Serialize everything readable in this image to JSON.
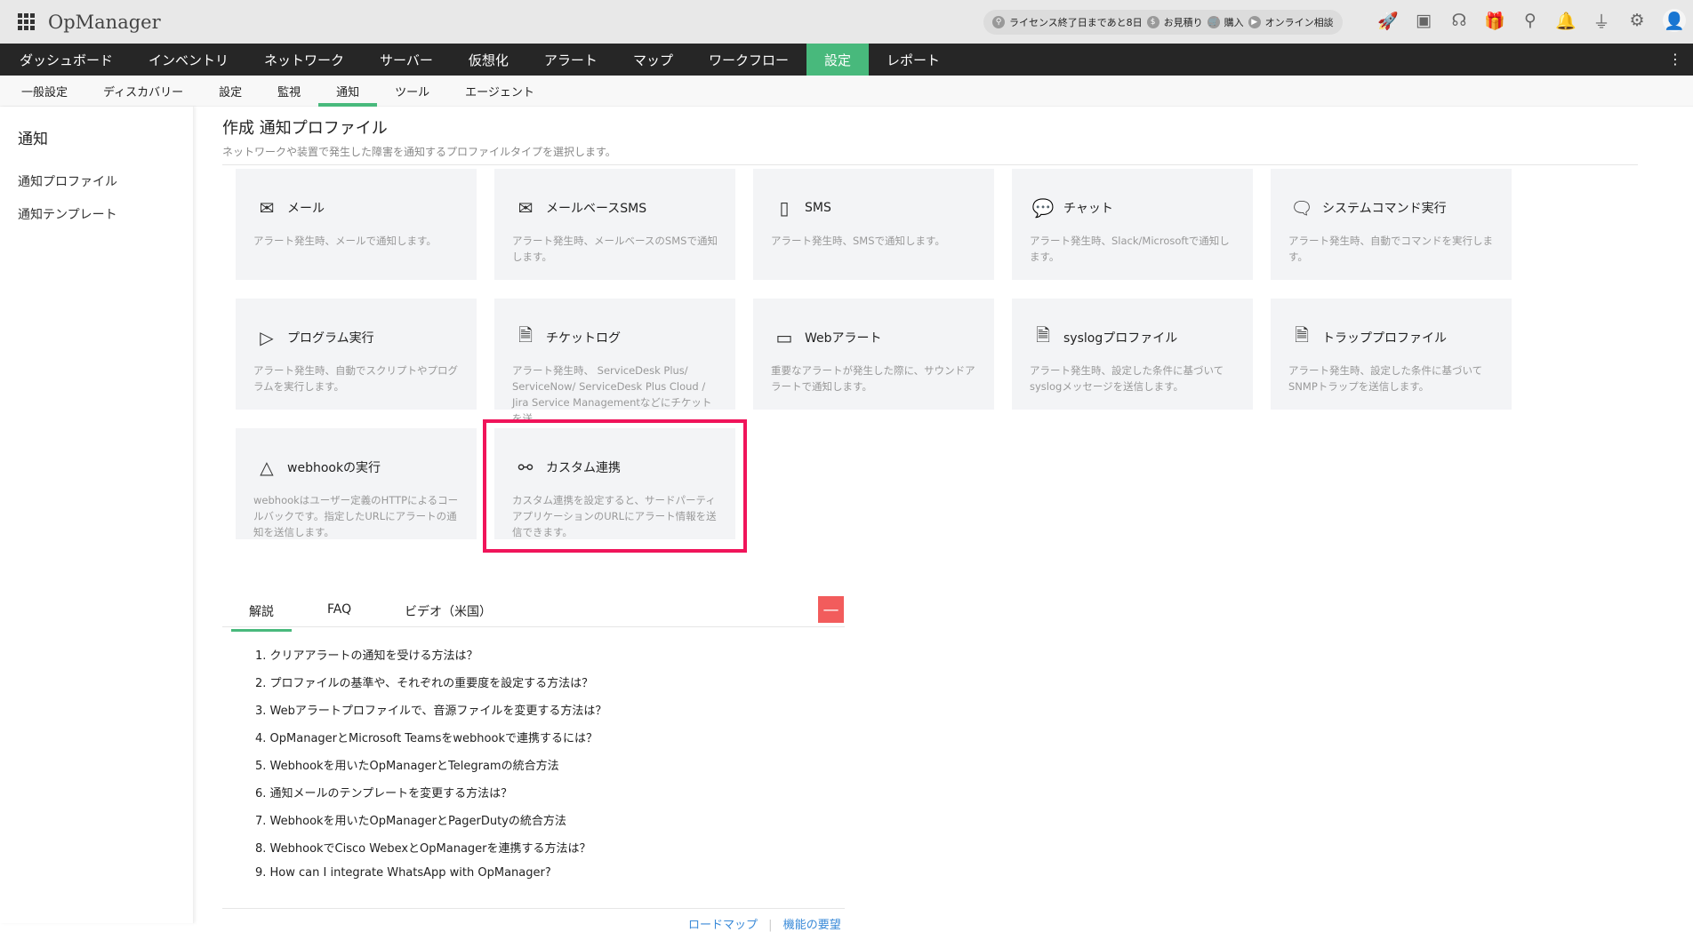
{
  "app": {
    "title": "OpManager"
  },
  "topbar": {
    "license": "ライセンス終了日まであと8日",
    "quote": "お見積り",
    "purchase": "購入",
    "consult": "オンライン相談"
  },
  "nav": [
    "ダッシュボード",
    "インベントリ",
    "ネットワーク",
    "サーバー",
    "仮想化",
    "アラート",
    "マップ",
    "ワークフロー",
    "設定",
    "レポート"
  ],
  "subnav": [
    "一般設定",
    "ディスカバリー",
    "設定",
    "監視",
    "通知",
    "ツール",
    "エージェント"
  ],
  "sidebar": {
    "title": "通知",
    "items": [
      "通知プロファイル",
      "通知テンプレート"
    ]
  },
  "main": {
    "title": "作成 通知プロファイル",
    "subtitle": "ネットワークや装置で発生した障害を通知するプロファイルタイプを選択します。",
    "cards": [
      {
        "title": "メール",
        "desc": "アラート発生時、メールで通知します。",
        "icon": "mail-icon"
      },
      {
        "title": "メールベースSMS",
        "desc": "アラート発生時、メールベースのSMSで通知します。",
        "icon": "mail-sms-icon"
      },
      {
        "title": "SMS",
        "desc": "アラート発生時、SMSで通知します。",
        "icon": "sms-icon"
      },
      {
        "title": "チャット",
        "desc": "アラート発生時、Slack/Microsoftで通知します。",
        "icon": "chat-icon"
      },
      {
        "title": "システムコマンド実行",
        "desc": "アラート発生時、自動でコマンドを実行します。",
        "icon": "command-icon"
      },
      {
        "title": "プログラム実行",
        "desc": "アラート発生時、自動でスクリプトやプログラムを実行します。",
        "icon": "program-icon"
      },
      {
        "title": "チケットログ",
        "desc": "アラート発生時、 ServiceDesk Plus/ ServiceNow/ ServiceDesk Plus Cloud / Jira Service Managementなどにチケットを送...",
        "icon": "ticket-icon"
      },
      {
        "title": "Webアラート",
        "desc": "重要なアラートが発生した際に、サウンドアラートで通知します。",
        "icon": "web-alert-icon"
      },
      {
        "title": "syslogプロファイル",
        "desc": "アラート発生時、設定した条件に基づいてsyslogメッセージを送信します。",
        "icon": "syslog-icon"
      },
      {
        "title": "トラッププロファイル",
        "desc": "アラート発生時、設定した条件に基づいてSNMPトラップを送信します。",
        "icon": "trap-icon"
      },
      {
        "title": "webhookの実行",
        "desc": "webhookはユーザー定義のHTTPによるコールバックです。指定したURLにアラートの通知を送信します。",
        "icon": "webhook-icon"
      },
      {
        "title": "カスタム連携",
        "desc": "カスタム連携を設定すると、サードパーティアプリケーションのURLにアラート情報を送信できます。",
        "icon": "custom-integration-icon"
      }
    ]
  },
  "help": {
    "tabs": [
      "解説",
      "FAQ",
      "ビデオ（米国）"
    ],
    "items": [
      "1. クリアアラートの通知を受ける方法は？",
      "2. プロファイルの基準や、それぞれの重要度を設定する方法は？",
      "3. Webアラートプロファイルで、音源ファイルを変更する方法は？",
      "4. OpManagerとMicrosoft Teamsをwebhookで連携するには？",
      "5. Webhookを用いたOpManagerとTelegramの統合方法",
      "6. 通知メールのテンプレートを変更する方法は？",
      "7. Webhookを用いたOpManagerとPagerDutyの統合方法",
      "8. WebhookでCisco WebexとOpManagerを連携する方法は？",
      "9. How can I integrate WhatsApp with OpManager?"
    ],
    "links": [
      "ロードマップ",
      "機能の要望"
    ]
  },
  "colors": {
    "accent": "#48b97c",
    "highlight": "#f0145a",
    "minus": "#f25c5c"
  }
}
